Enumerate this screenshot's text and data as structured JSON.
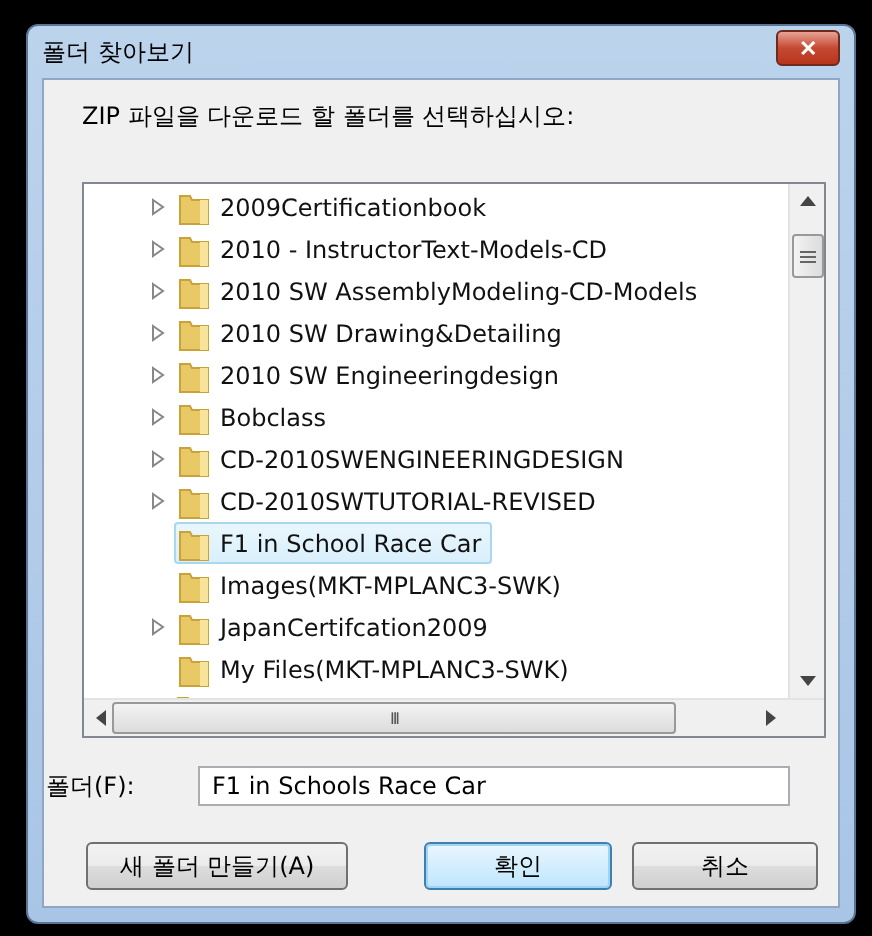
{
  "window": {
    "title": "폴더 찾아보기",
    "close": "✕"
  },
  "prompt": "ZIP 파일을 다운로드 할 폴더를 선택하십시오:",
  "tree": {
    "items": [
      {
        "label": "2009Certificationbook",
        "expandable": true,
        "selected": false
      },
      {
        "label": "2010 - InstructorText-Models-CD",
        "expandable": true,
        "selected": false
      },
      {
        "label": "2010 SW AssemblyModeling-CD-Models",
        "expandable": true,
        "selected": false
      },
      {
        "label": "2010 SW Drawing&Detailing",
        "expandable": true,
        "selected": false
      },
      {
        "label": "2010 SW Engineeringdesign",
        "expandable": true,
        "selected": false
      },
      {
        "label": "Bobclass",
        "expandable": true,
        "selected": false
      },
      {
        "label": "CD-2010SWENGINEERINGDESIGN",
        "expandable": true,
        "selected": false
      },
      {
        "label": "CD-2010SWTUTORIAL-REVISED",
        "expandable": true,
        "selected": false
      },
      {
        "label": "F1 in School Race Car",
        "expandable": false,
        "selected": true
      },
      {
        "label": "Images(MKT-MPLANC3-SWK)",
        "expandable": false,
        "selected": false
      },
      {
        "label": "JapanCertifcation2009",
        "expandable": true,
        "selected": false
      },
      {
        "label": "My Files(MKT-MPLANC3-SWK)",
        "expandable": false,
        "selected": false
      }
    ],
    "hscroll_grip": "III"
  },
  "folder_field": {
    "label": "폴더(F):",
    "value": "F1 in Schools Race Car"
  },
  "buttons": [
    {
      "label": "새 폴더 만들기(A)",
      "default": false
    },
    {
      "label": "확인",
      "default": true
    },
    {
      "label": "취소",
      "default": false
    }
  ]
}
